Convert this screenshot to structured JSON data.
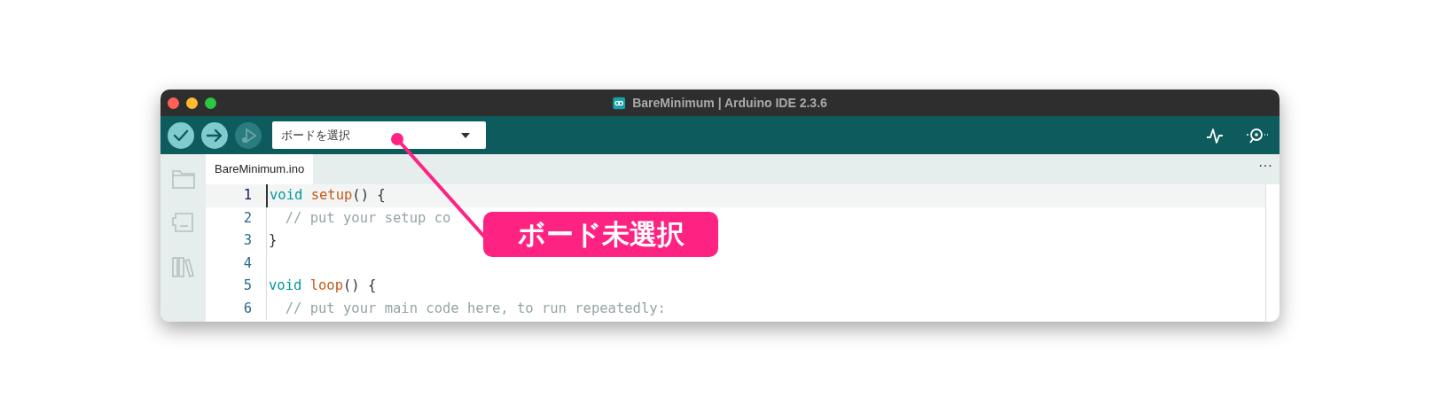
{
  "window": {
    "title": "BareMinimum | Arduino IDE 2.3.6"
  },
  "toolbar": {
    "buttons": [
      {
        "kind": "verify",
        "disabled": false
      },
      {
        "kind": "upload",
        "disabled": false
      },
      {
        "kind": "debug",
        "disabled": true
      }
    ],
    "board_select": {
      "value": "ボードを選択"
    }
  },
  "tabs": [
    {
      "label": "BareMinimum.ino",
      "selected": true
    }
  ],
  "more": "···",
  "editor": {
    "lines": [
      {
        "number": "1",
        "current": true,
        "tokens": [
          {
            "kind": "keyword",
            "text": "void "
          },
          {
            "kind": "function",
            "text": "setup"
          },
          {
            "kind": "plain",
            "text": "() {"
          }
        ]
      },
      {
        "number": "2",
        "current": false,
        "tokens": [
          {
            "kind": "comment",
            "text": "  // put your setup co"
          }
        ]
      },
      {
        "number": "3",
        "current": false,
        "tokens": [
          {
            "kind": "plain",
            "text": "}"
          }
        ]
      },
      {
        "number": "4",
        "current": false
      },
      {
        "number": "5",
        "current": false,
        "tokens": [
          {
            "kind": "keyword",
            "text": "void "
          },
          {
            "kind": "function",
            "text": "loop"
          },
          {
            "kind": "plain",
            "text": "() {"
          }
        ]
      },
      {
        "number": "6",
        "current": false,
        "tokens": [
          {
            "kind": "comment",
            "text": "  // put your main code here, to run repeatedly:"
          }
        ]
      }
    ]
  },
  "callout": {
    "text": "ボード未選択"
  }
}
